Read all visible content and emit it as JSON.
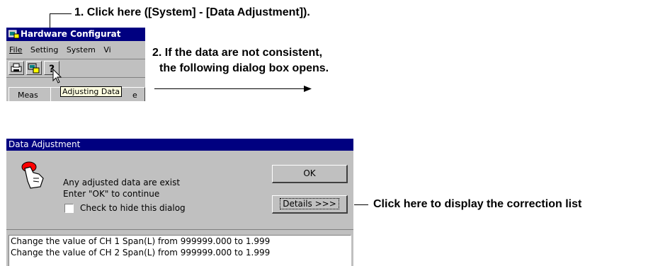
{
  "callouts": {
    "step1": "1. Click here ([System] - [Data Adjustment]).",
    "step2_line1": "2. If the data are not consistent,",
    "step2_line2": "the following dialog box opens.",
    "details_note": "Click here to display the correction list"
  },
  "hw_window": {
    "title": "Hardware Configurat",
    "menu": [
      "File",
      "Setting",
      "System",
      "Vi"
    ],
    "tooltip": "Adjusting Data",
    "tab_meas": "Meas",
    "tab_partial": "e"
  },
  "dialog": {
    "title": "Data Adjustment",
    "message_line1": "Any adjusted data are exist",
    "message_line2": "Enter \"OK\" to continue",
    "checkbox_label": "Check to hide this dialog",
    "ok_label": "OK",
    "details_label": "Details >>>",
    "list_items": [
      "Change the value of CH 1 Span(L) from 999999.000 to 1.999",
      "Change the value of CH 2 Span(L) from 999999.000 to 1.999"
    ]
  }
}
